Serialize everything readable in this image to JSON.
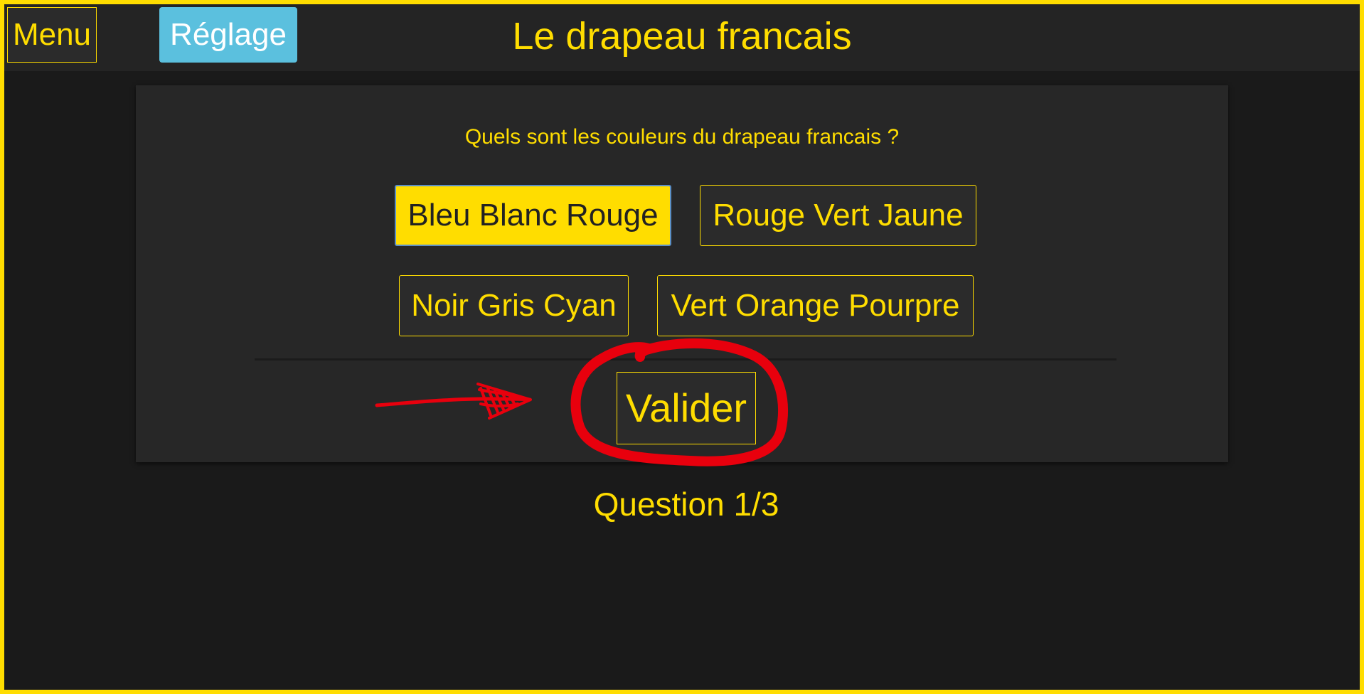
{
  "header": {
    "menu_label": "Menu",
    "settings_label": "Réglage",
    "title": "Le drapeau francais"
  },
  "quiz": {
    "question": "Quels sont les couleurs du drapeau francais ?",
    "options": [
      {
        "label": "Bleu Blanc Rouge",
        "selected": true
      },
      {
        "label": "Rouge Vert Jaune",
        "selected": false
      },
      {
        "label": "Noir Gris Cyan",
        "selected": false
      },
      {
        "label": "Vert Orange Pourpre",
        "selected": false
      }
    ],
    "validate_label": "Valider",
    "progress": "Question 1/3"
  },
  "colors": {
    "accent": "#ffdd00",
    "settings_button": "#5bc0de",
    "background": "#1a1a1a",
    "panel": "#272727",
    "annotation": "#e8000d"
  }
}
